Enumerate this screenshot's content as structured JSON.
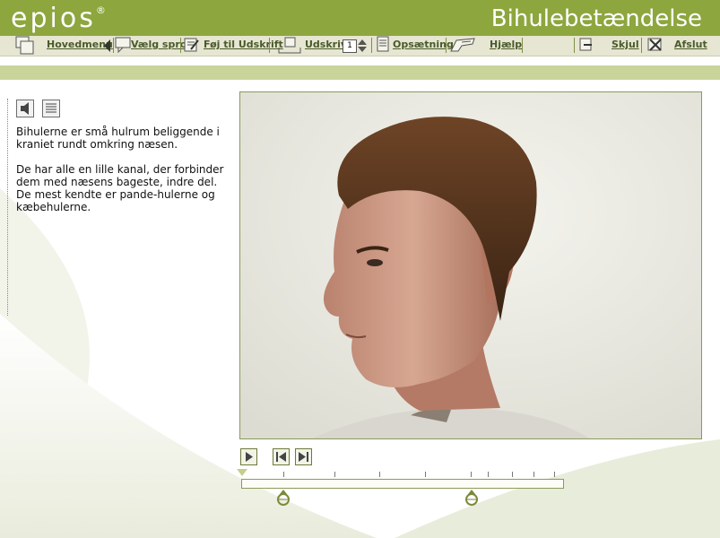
{
  "header": {
    "logo": "epios",
    "logo_mark": "®",
    "title": "Bihulebetændelse"
  },
  "toolbar": {
    "items": [
      {
        "label": "Hovedmenu",
        "icon": "pages-icon"
      },
      {
        "label": "Vælg sprog",
        "icon": "speech-bubble-icon"
      },
      {
        "label": "Føj til Udskrift",
        "icon": "note-add-icon"
      },
      {
        "label": "Udskriv",
        "icon": "printer-icon"
      },
      {
        "label": "Opsætning",
        "icon": "document-icon"
      },
      {
        "label": "Hjælp",
        "icon": "help-hand-icon"
      },
      {
        "label": "Skjul",
        "icon": "hide-icon"
      },
      {
        "label": "Afslut",
        "icon": "close-icon"
      }
    ],
    "copies_value": "1"
  },
  "content": {
    "paragraph1": "Bihulerne er små hulrum beliggende i kraniet rundt omkring næsen.",
    "paragraph2": "De har alle en lille kanal, der forbinder dem med næsens bageste, indre del. De mest kendte er pande-hulerne og kæbehulerne.",
    "icons": [
      "speaker-icon",
      "text-lines-icon"
    ]
  },
  "player": {
    "buttons": [
      "play-icon",
      "previous-icon",
      "next-icon"
    ],
    "progress": 0.0
  },
  "colors": {
    "brand_green": "#8da63e",
    "toolbar_bg": "#e6e6d2",
    "stripe": "#c9d49b"
  }
}
